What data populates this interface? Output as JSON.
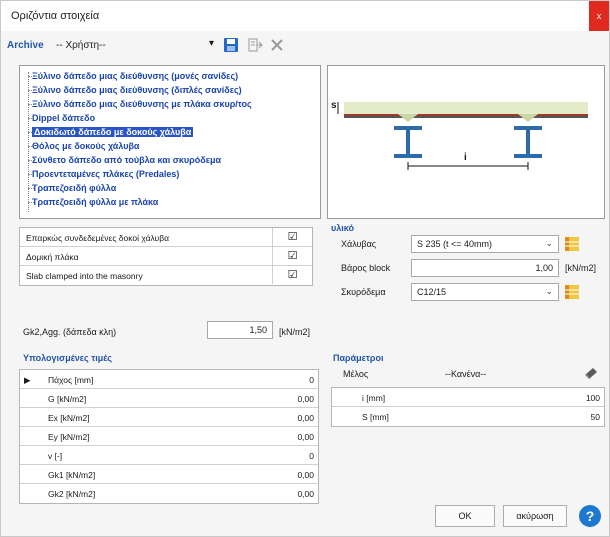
{
  "window": {
    "title": "Οριζόντια στοιχεία",
    "close_glyph": "x"
  },
  "toolbar": {
    "archive_label": "Archive",
    "archive_value": "-- Χρήστη--",
    "icons": [
      "save-icon",
      "export-icon",
      "delete-icon"
    ]
  },
  "tree": {
    "items": [
      "Ξύλινο δάπεδο μιας διεύθυνσης (μονές σανίδες)",
      "Ξύλινο δάπεδο μιας διεύθυνσης (διπλές σανίδες)",
      "Ξύλινο δάπεδο μιας διεύθυνσης με πλάκα σκυρ/τος",
      "Dippel δάπεδο",
      "Δοκιδωτό δάπεδο με δοκούς χάλυβα",
      "Θόλος με δοκούς χάλυβα",
      "Σύνθετο δάπεδο από τούβλα και σκυρόδεμα",
      "Προεντεταμένες πλάκες (Predales)",
      "Τραπεζοειδή φύλλα",
      "Τραπεζοειδή φύλλα με πλάκα"
    ],
    "selected_index": 4
  },
  "preview": {
    "s_label": "s",
    "i_label": "i"
  },
  "options": [
    {
      "label": "Επαρκώς συνδεδεμένες δοκοί χάλυβα",
      "checked": "☑"
    },
    {
      "label": "Δομική πλάκα",
      "checked": "☑"
    },
    {
      "label": "Slab clamped into the masonry",
      "checked": "☑"
    }
  ],
  "material": {
    "title": "υλικό",
    "steel_label": "Χάλυβας",
    "steel_value": "S 235 (t <= 40mm)",
    "block_label": "Βάρος block",
    "block_value": "1,00",
    "block_unit": "[kN/m2]",
    "concrete_label": "Σκυρόδεμα",
    "concrete_value": "C12/15"
  },
  "gk2": {
    "label": "Gk2,Agg. (δάπεδα κλη)",
    "value": "1,50",
    "unit": "[kN/m2]"
  },
  "calculated": {
    "title": "Υπολογισμένες τιμές",
    "rows": [
      {
        "marker": "▶",
        "name": "Πάχος [mm]",
        "value": "0"
      },
      {
        "marker": "",
        "name": "G [kN/m2]",
        "value": "0,00"
      },
      {
        "marker": "",
        "name": "Ex [kN/m2]",
        "value": "0,00"
      },
      {
        "marker": "",
        "name": "Ey [kN/m2]",
        "value": "0,00"
      },
      {
        "marker": "",
        "name": "v [-]",
        "value": "0"
      },
      {
        "marker": "",
        "name": "Gk1 [kN/m2]",
        "value": "0,00"
      },
      {
        "marker": "",
        "name": "Gk2 [kN/m2]",
        "value": "0,00"
      }
    ]
  },
  "parameters": {
    "title": "Παράμετροι",
    "member_label": "Μέλος",
    "member_value": "--Κανένα--",
    "rows": [
      {
        "name": "i [mm]",
        "value": "100"
      },
      {
        "name": "S [mm]",
        "value": "50"
      }
    ]
  },
  "buttons": {
    "ok": "OK",
    "cancel": "ακύρωση",
    "help": "?"
  },
  "colors": {
    "accent": "#2255aa",
    "selection": "#2a55c7",
    "close": "#e0291f",
    "help": "#1e78d2"
  }
}
